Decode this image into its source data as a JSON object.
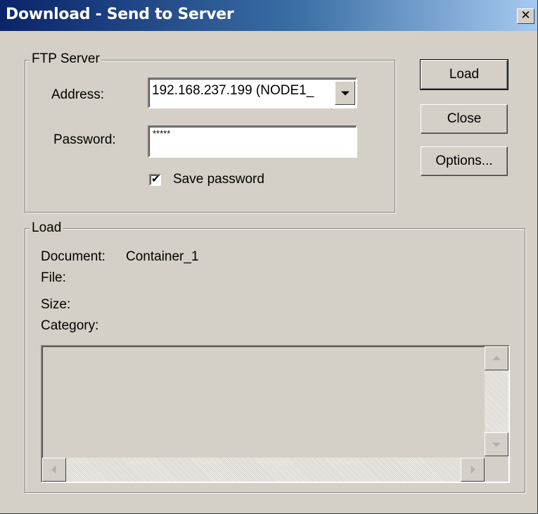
{
  "window": {
    "title": "Download - Send to Server",
    "close_glyph": "✕"
  },
  "ftp_server": {
    "group_title": "FTP Server",
    "address_label": "Address:",
    "address_value": "192.168.237.199 (NODE1_",
    "password_label": "Password:",
    "password_value": "*****",
    "save_password_label": "Save password",
    "save_password_checked": true
  },
  "buttons": {
    "load": "Load",
    "close": "Close",
    "options": "Options..."
  },
  "load_group": {
    "group_title": "Load",
    "document_label": "Document:",
    "document_value": "Container_1",
    "file_label": "File:",
    "file_value": "",
    "size_label": "Size:",
    "size_value": "",
    "category_label": "Category:",
    "category_value": ""
  },
  "icons": {
    "checkmark": "✔"
  },
  "colors": {
    "dialog_bg": "#d4d0c8",
    "titlebar_start": "#0a246a",
    "titlebar_end": "#a6caf0"
  }
}
